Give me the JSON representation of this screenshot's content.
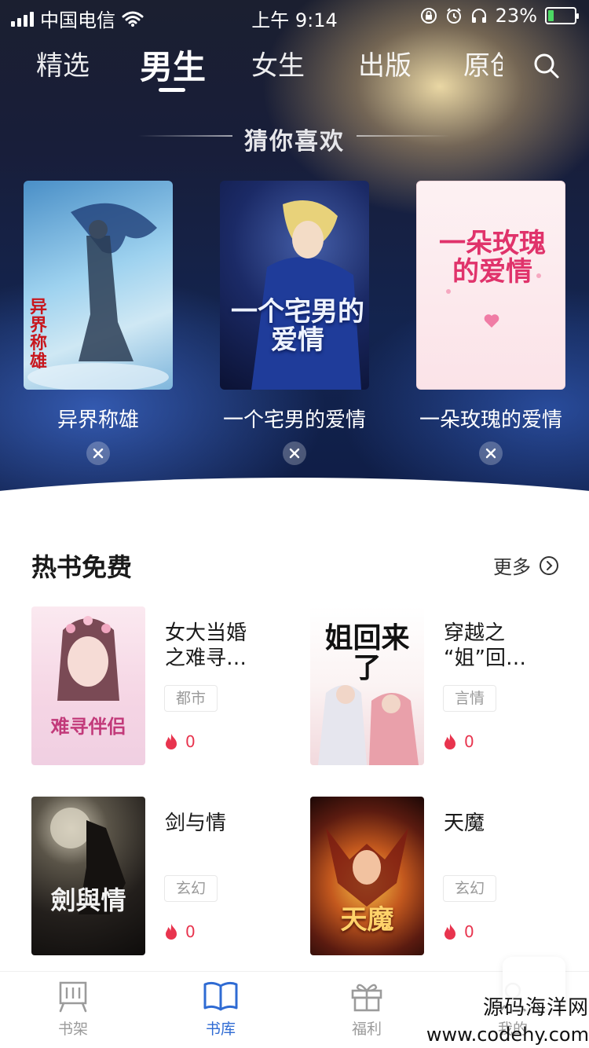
{
  "status_bar": {
    "carrier": "中国电信",
    "time": "上午 9:14",
    "battery": "23%",
    "battery_level": 0.23
  },
  "top_tabs": [
    {
      "label": "精选",
      "active": false
    },
    {
      "label": "男生",
      "active": true
    },
    {
      "label": "女生",
      "active": false
    },
    {
      "label": "出版",
      "active": false
    },
    {
      "label": "原创",
      "active": false
    }
  ],
  "guess": {
    "title": "猜你喜欢",
    "books": [
      {
        "title": "异界称雄",
        "cover_text": "异界称雄"
      },
      {
        "title": "一个宅男的爱情",
        "cover_text": "一个宅男的爱情"
      },
      {
        "title": "一朵玫瑰的爱情",
        "cover_text": "一朵玫瑰的爱情"
      }
    ]
  },
  "hot_free": {
    "title": "热书免费",
    "more": "更多",
    "books": [
      {
        "title_line1": "女大当婚",
        "title_line2": "之难寻…",
        "tag": "都市",
        "heat": "0",
        "cover_text": "难寻伴侣"
      },
      {
        "title_line1": "穿越之",
        "title_line2": "“姐”回…",
        "tag": "言情",
        "heat": "0",
        "cover_text": "姐回来了"
      },
      {
        "title_line1": "剑与情",
        "title_line2": "",
        "tag": "玄幻",
        "heat": "0",
        "cover_text": "劍與情"
      },
      {
        "title_line1": "天魔",
        "title_line2": "",
        "tag": "玄幻",
        "heat": "0",
        "cover_text": "天魔"
      }
    ]
  },
  "bottom_nav": [
    {
      "label": "书架",
      "icon": "bookshelf-icon",
      "active": false
    },
    {
      "label": "书库",
      "icon": "open-book-icon",
      "active": true
    },
    {
      "label": "福利",
      "icon": "gift-icon",
      "active": false
    },
    {
      "label": "我的",
      "icon": "profile-icon",
      "active": false
    }
  ],
  "watermark": {
    "line1": "源码海洋网",
    "line2": "www.codehy.com"
  },
  "colors": {
    "accent": "#2f6bd3",
    "heat": "#e8344e",
    "tag_text": "#9a9a9a"
  }
}
